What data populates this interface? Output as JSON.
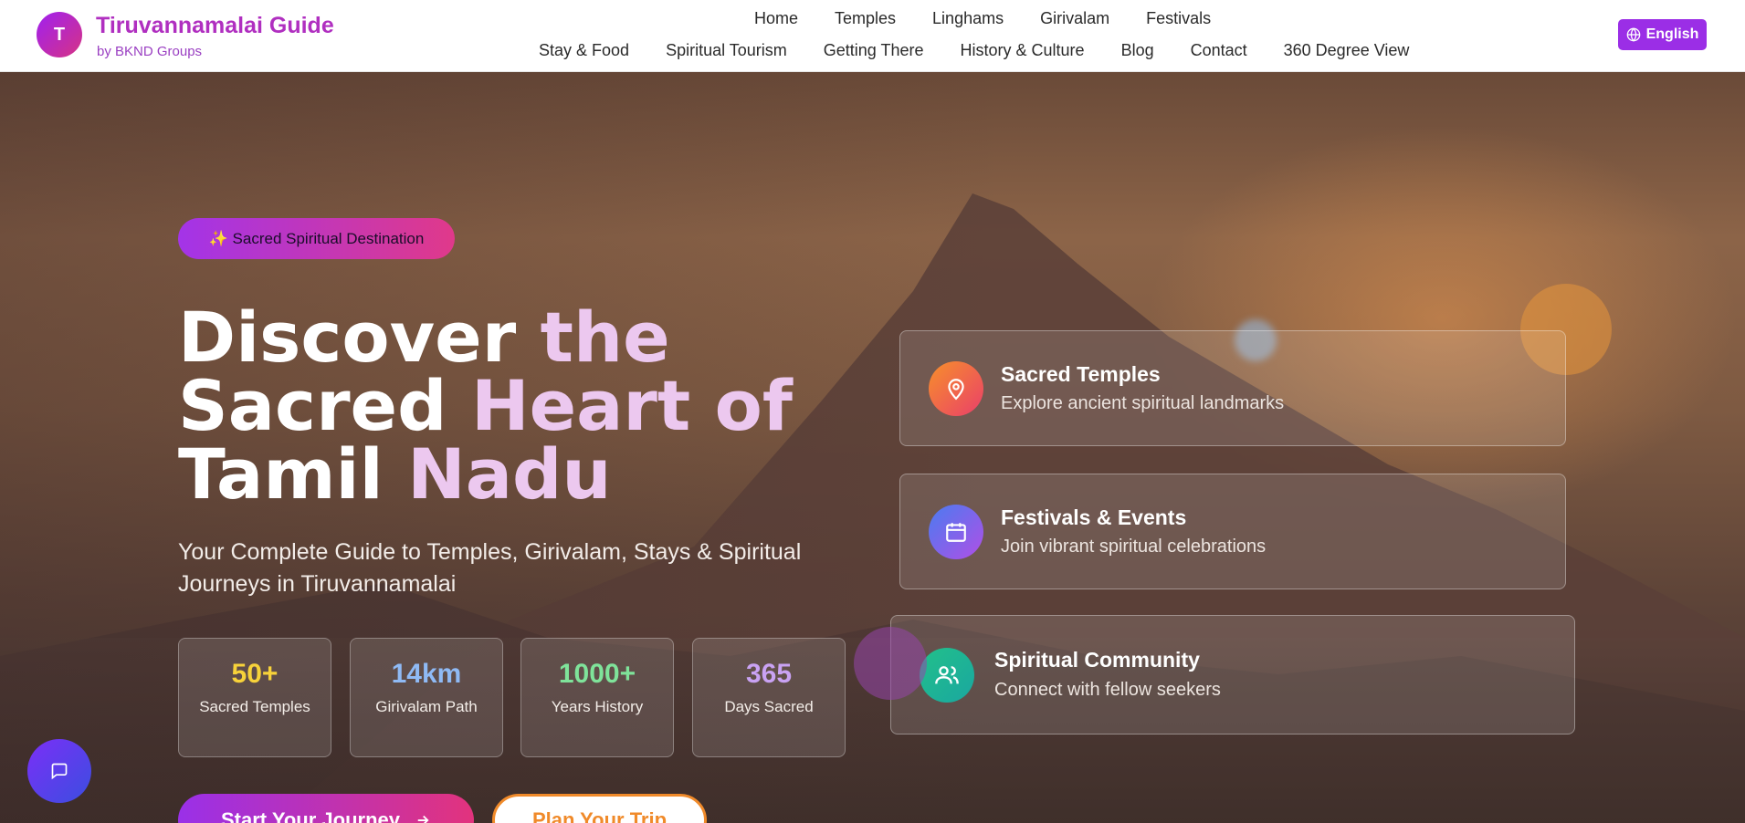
{
  "brand": {
    "logo_letter": "T",
    "title": "Tiruvannamalai Guide",
    "subtitle": "by BKND Groups"
  },
  "nav": {
    "row1": [
      "Home",
      "Temples",
      "Linghams",
      "Girivalam",
      "Festivals"
    ],
    "row2": [
      "Stay & Food",
      "Spiritual Tourism",
      "Getting There",
      "History & Culture",
      "Blog",
      "Contact",
      "360 Degree View"
    ]
  },
  "language_button": {
    "label": "English",
    "icon": "globe-icon"
  },
  "hero": {
    "badge": "✨ Sacred Spiritual Destination",
    "title_line1_white": "Discover ",
    "title_line1_pink": "the",
    "title_line2_white": "Sacred ",
    "title_line2_pink": "Heart of",
    "title_line3_white": "Tamil ",
    "title_line3_pink": "Nadu",
    "subtitle": "Your Complete Guide to Temples, Girivalam, Stays & Spiritual Journeys in Tiruvannamalai"
  },
  "stats": [
    {
      "value": "50+",
      "label": "Sacred Temples",
      "color": "#f7d23a"
    },
    {
      "value": "14km",
      "label": "Girivalam Path",
      "color": "#8fbaf5"
    },
    {
      "value": "1000+",
      "label": "Years History",
      "color": "#7fe39a"
    },
    {
      "value": "365",
      "label": "Days Sacred",
      "color": "#c9a2f3"
    }
  ],
  "buttons": {
    "start": "Start Your Journey",
    "start_icon": "arrow-right-icon",
    "plan": "Plan Your Trip"
  },
  "cards": [
    {
      "title": "Sacred Temples",
      "desc": "Explore ancient spiritual landmarks",
      "icon": "map-pin-icon",
      "color_from": "#f7902a",
      "color_to": "#ea3f6a"
    },
    {
      "title": "Festivals & Events",
      "desc": "Join vibrant spiritual celebrations",
      "icon": "calendar-icon",
      "color_from": "#4a7cf0",
      "color_to": "#b04fe6"
    },
    {
      "title": "Spiritual Community",
      "desc": "Connect with fellow seekers",
      "icon": "users-icon",
      "color_from": "#22c08a",
      "color_to": "#1aa7a0"
    }
  ],
  "chat": {
    "icon": "chat-icon"
  }
}
